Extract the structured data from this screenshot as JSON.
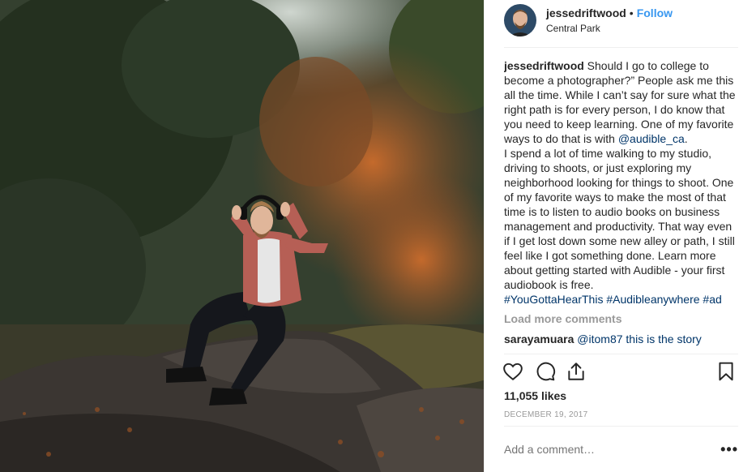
{
  "post": {
    "username": "jessedriftwood",
    "separator": "•",
    "follow_label": "Follow",
    "location": "Central Park"
  },
  "caption": {
    "username": "jessedriftwood",
    "text_1": " Should I go to college to become a photographer?” People ask me this all the time. While I can’t say for sure what the right path is for every person, I do know that you need to keep learning. One of my favorite ways to do that is with ",
    "mention": "@audible_ca",
    "text_2": ".\nI spend a lot of time walking to my studio, driving to shoots, or just exploring my neighborhood looking for things to shoot. One of my favorite ways to make the most of that time is to listen to audio books on business management and productivity. That way even if I get lost down some new alley or path, I still feel like I got something done. Learn more about getting started with Audible - your first audiobook is free.\n",
    "hashtags": "#YouGottaHearThis #Audibleanywhere #ad"
  },
  "comments": {
    "load_more_label": "Load more comments",
    "partial_comment_user": "sarayamuara",
    "partial_comment_text": " @itom87 this is the story"
  },
  "actions": {
    "like_icon": "heart-icon",
    "comment_icon": "comment-icon",
    "share_icon": "share-icon",
    "save_icon": "bookmark-icon"
  },
  "likes_text": "11,055 likes",
  "date_text": "DECEMBER 19, 2017",
  "comment_input": {
    "placeholder": "Add a comment…",
    "more_label": "•••"
  },
  "colors": {
    "link": "#3897f0",
    "mention": "#003569",
    "muted": "#999999"
  }
}
